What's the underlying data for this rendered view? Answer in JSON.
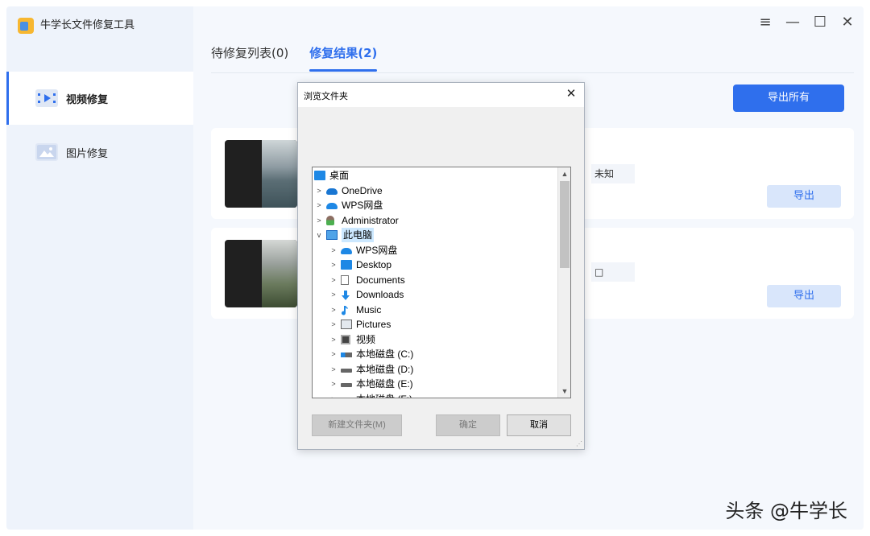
{
  "app": {
    "title": "牛学长文件修复工具"
  },
  "sidebar": {
    "items": [
      {
        "label": "视频修复",
        "active": true,
        "icon": "video-icon"
      },
      {
        "label": "图片修复",
        "active": false,
        "icon": "image-icon"
      }
    ]
  },
  "window_controls": {
    "menu": "≡",
    "minimize": "—",
    "maximize": "☐",
    "close": "✕"
  },
  "tabs": [
    {
      "label": "待修复列表(0)",
      "active": false
    },
    {
      "label": "修复结果(2)",
      "active": true
    }
  ],
  "toolbar": {
    "export_all_label": "导出所有"
  },
  "cards": [
    {
      "info": "未知",
      "export_label": "导出"
    },
    {
      "info": "□",
      "export_label": "导出"
    }
  ],
  "watermark": "头条 @牛学长",
  "dialog": {
    "title": "浏览文件夹",
    "close": "✕",
    "tree": [
      {
        "label": "桌面",
        "icon": "desktop-icon",
        "level": 0,
        "expander": ""
      },
      {
        "label": "OneDrive",
        "icon": "onedrive-icon",
        "level": 1,
        "expander": ">"
      },
      {
        "label": "WPS网盘",
        "icon": "wps-cloud-icon",
        "level": 1,
        "expander": ">"
      },
      {
        "label": "Administrator",
        "icon": "user-icon",
        "level": 1,
        "expander": ">"
      },
      {
        "label": "此电脑",
        "icon": "computer-icon",
        "level": 1,
        "expander": "v",
        "selected": true
      },
      {
        "label": "WPS网盘",
        "icon": "wps-cloud-icon",
        "level": 2,
        "expander": ">"
      },
      {
        "label": "Desktop",
        "icon": "desktop-icon",
        "level": 2,
        "expander": ">"
      },
      {
        "label": "Documents",
        "icon": "documents-icon",
        "level": 2,
        "expander": ">"
      },
      {
        "label": "Downloads",
        "icon": "downloads-icon",
        "level": 2,
        "expander": ">"
      },
      {
        "label": "Music",
        "icon": "music-icon",
        "level": 2,
        "expander": ">"
      },
      {
        "label": "Pictures",
        "icon": "pictures-icon",
        "level": 2,
        "expander": ">"
      },
      {
        "label": "视频",
        "icon": "videos-icon",
        "level": 2,
        "expander": ">"
      },
      {
        "label": "本地磁盘 (C:)",
        "icon": "drive-c-icon",
        "level": 2,
        "expander": ">"
      },
      {
        "label": "本地磁盘 (D:)",
        "icon": "drive-icon",
        "level": 2,
        "expander": ">"
      },
      {
        "label": "本地磁盘 (E:)",
        "icon": "drive-icon",
        "level": 2,
        "expander": ">"
      },
      {
        "label": "本地磁盘 (F:)",
        "icon": "drive-icon",
        "level": 2,
        "expander": ">"
      }
    ],
    "buttons": {
      "new_folder": "新建文件夹(M)",
      "ok": "确定",
      "cancel": "取消"
    }
  }
}
